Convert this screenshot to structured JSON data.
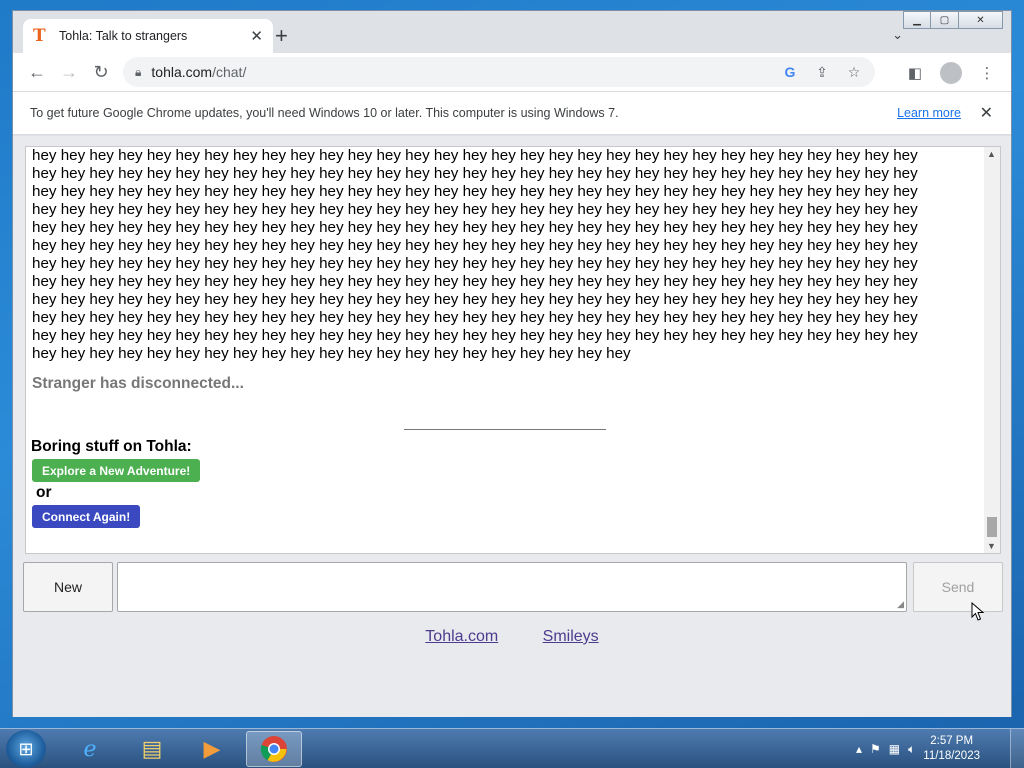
{
  "browser": {
    "tab_title": "Tohla: Talk to strangers",
    "tab_favicon": "T",
    "url_host": "tohla.com",
    "url_path": "/chat/",
    "infobar_text": "To get future Google Chrome updates, you'll need Windows 10 or later. This computer is using Windows 7.",
    "infobar_link": "Learn more"
  },
  "chat": {
    "message_lines": [
      "hey hey hey hey hey hey hey hey hey hey hey hey hey hey hey hey hey hey hey hey hey hey hey hey hey hey hey hey hey hey hey",
      "hey hey hey hey hey hey hey hey hey hey hey hey hey hey hey hey hey hey hey hey hey hey hey hey hey hey hey hey hey hey hey",
      "hey hey hey hey hey hey hey hey hey hey hey hey hey hey hey hey hey hey hey hey hey hey hey hey hey hey hey hey hey hey hey",
      "hey hey hey hey hey hey hey hey hey hey hey hey hey hey hey hey hey hey hey hey hey hey hey hey hey hey hey hey hey hey hey",
      "hey hey hey hey hey hey hey hey hey hey hey hey hey hey hey hey hey hey hey hey hey hey hey hey hey hey hey hey hey hey hey",
      "hey hey hey hey hey hey hey hey hey hey hey hey hey hey hey hey hey hey hey hey hey hey hey hey hey hey hey hey hey hey hey",
      "hey hey hey hey hey hey hey hey hey hey hey hey hey hey hey hey hey hey hey hey hey hey hey hey hey hey hey hey hey hey hey",
      "hey hey hey hey hey hey hey hey hey hey hey hey hey hey hey hey hey hey hey hey hey hey hey hey hey hey hey hey hey hey hey",
      "hey hey hey hey hey hey hey hey hey hey hey hey hey hey hey hey hey hey hey hey hey hey hey hey hey hey hey hey hey hey hey",
      "hey hey hey hey hey hey hey hey hey hey hey hey hey hey hey hey hey hey hey hey hey hey hey hey hey hey hey hey hey hey hey",
      "hey hey hey hey hey hey hey hey hey hey hey hey hey hey hey hey hey hey hey hey hey hey hey hey hey hey hey hey hey hey hey",
      "hey hey hey hey hey hey hey hey hey hey hey hey hey hey hey hey hey hey hey hey hey"
    ],
    "disconnected_text": "Stranger has disconnected...",
    "boring_text": "Boring stuff on  Tohla:",
    "adventure_button": "Explore a New Adventure!",
    "or_text": "or",
    "connect_again_button": "Connect Again!"
  },
  "controls": {
    "new_button": "New",
    "send_button": "Send"
  },
  "footer": {
    "link1": "Tohla.com",
    "link2": "Smileys"
  },
  "taskbar": {
    "time": "2:57 PM",
    "date": "11/18/2023"
  },
  "colors": {
    "adventure_button": "#4caf50",
    "connect_button": "#3a49c0",
    "link": "#4d3c8e"
  }
}
